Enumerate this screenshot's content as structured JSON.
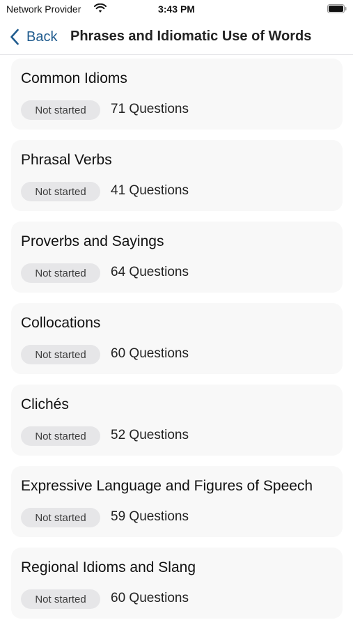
{
  "status_bar": {
    "carrier": "Network Provider",
    "time": "3:43 PM",
    "icons": [
      "wifi-icon",
      "battery-icon"
    ]
  },
  "nav": {
    "back_label": "Back",
    "back_icon": "chevron-left-icon",
    "title": "Phrases and Idiomatic Use of Words",
    "accent_color": "#1f5b8e"
  },
  "topics": [
    {
      "title": "Common Idioms",
      "status": "Not started",
      "questions": "71 Questions"
    },
    {
      "title": "Phrasal Verbs",
      "status": "Not started",
      "questions": "41 Questions"
    },
    {
      "title": "Proverbs and Sayings",
      "status": "Not started",
      "questions": "64 Questions"
    },
    {
      "title": "Collocations",
      "status": "Not started",
      "questions": "60 Questions"
    },
    {
      "title": "Clichés",
      "status": "Not started",
      "questions": "52 Questions"
    },
    {
      "title": "Expressive Language and Figures of Speech",
      "status": "Not started",
      "questions": "59 Questions"
    },
    {
      "title": "Regional Idioms and Slang",
      "status": "Not started",
      "questions": "60 Questions"
    }
  ]
}
